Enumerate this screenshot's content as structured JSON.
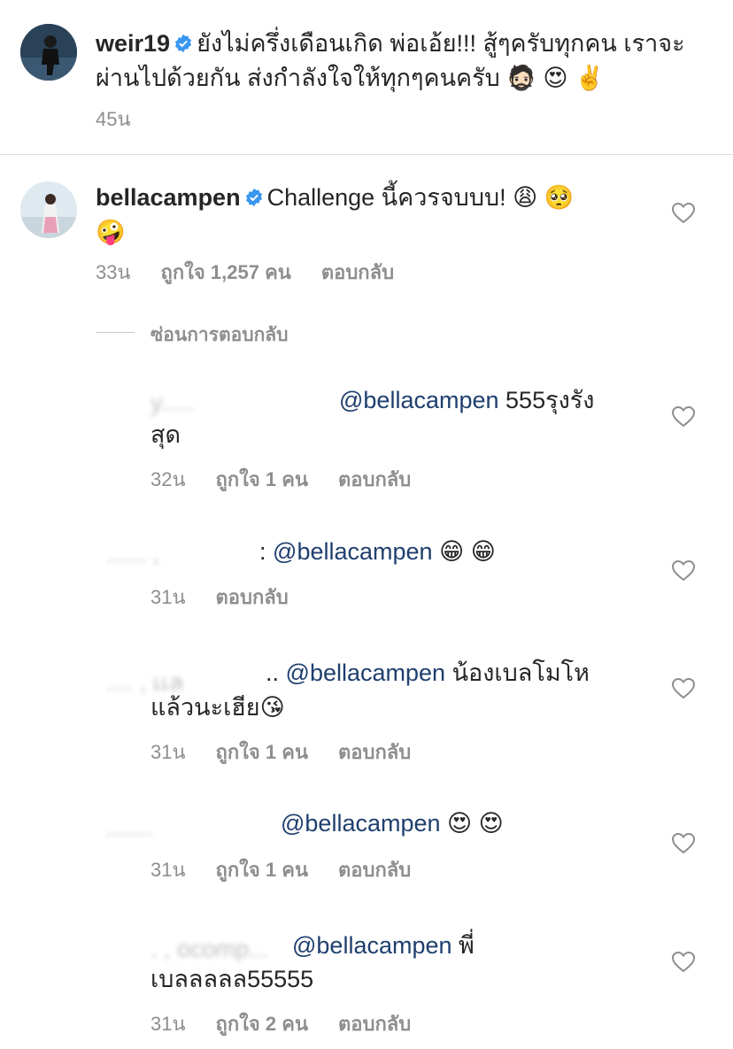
{
  "post": {
    "username": "weir19",
    "caption_line1": "ยังไม่ครึ่งเดือนเกิด พ่อเอ้ย!!! สู้ๆครับทุกคน เราจะ",
    "caption_line2": "ผ่านไปด้วยกัน ส่งกำลังใจให้ทุกๆคนครับ",
    "caption_emojis": "🧔🏻 😍 ✌️",
    "time": "45น"
  },
  "comment": {
    "username": "bellacampen",
    "text": "Challenge นี้ควรจบบบ!",
    "emojis_line1": "😩 🥺",
    "emoji_line2": "🤪",
    "time": "33น",
    "likes": "ถูกใจ 1,257 คน",
    "reply_label": "ตอบกลับ"
  },
  "hide_replies_label": "ซ่อนการตอบกลับ",
  "replies": [
    {
      "blurred_name": "y.....",
      "mention": "@bellacampen",
      "text_line1": "555รุงรัง",
      "text_line2": "สุด",
      "time": "32น",
      "likes": "ถูกใจ 1 คน",
      "reply_label": "ตอบกลับ"
    },
    {
      "blurred_name": "......  ,",
      "separator": ":",
      "mention": "@bellacampen",
      "emojis": "😁 😁",
      "time": "31น",
      "reply_label": "ตอบกลับ"
    },
    {
      "blurred_name": "....  ,  เเล",
      "separator": "..",
      "mention": "@bellacampen",
      "text_line1": "น้องเบลโมโห",
      "text_line2": "แล้วนะเฮีย",
      "emoji": "😘",
      "time": "31น",
      "likes": "ถูกใจ 1 คน",
      "reply_label": "ตอบกลับ"
    },
    {
      "blurred_name": ".......",
      "mention": "@bellacampen",
      "emojis": "😍 😍",
      "time": "31น",
      "likes": "ถูกใจ 1 คน",
      "reply_label": "ตอบกลับ"
    },
    {
      "blurred_name": ". , ­ocomp...",
      "mention": "@bellacampen",
      "text_line1": "พี่",
      "text_line2": "เบลลลลล55555",
      "time": "31น",
      "likes": "ถูกใจ 2 คน",
      "reply_label": "ตอบกลับ"
    }
  ],
  "colors": {
    "verified": "#3897f0",
    "mention": "#1f3f6e",
    "meta": "#8e8e8e"
  }
}
